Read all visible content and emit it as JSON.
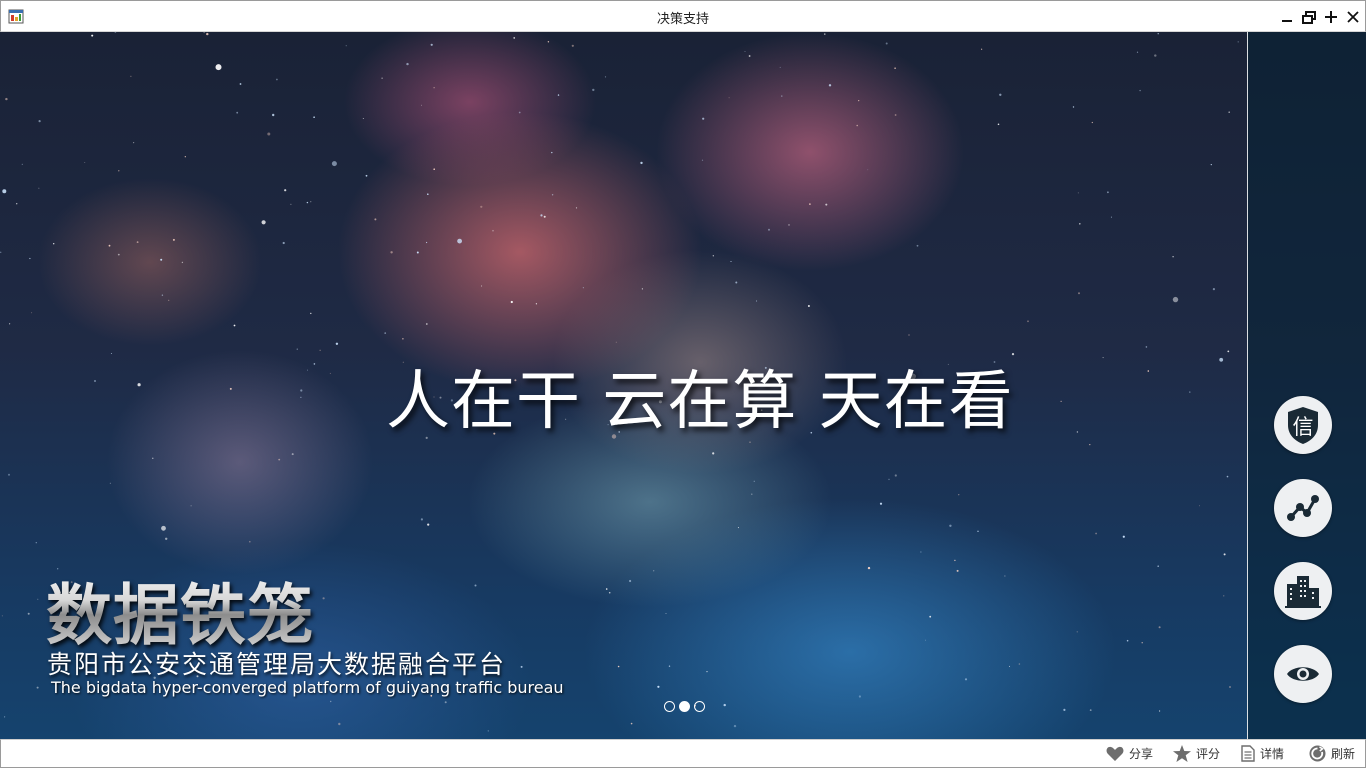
{
  "window": {
    "title": "决策支持",
    "controls": [
      "minimize",
      "restore",
      "maximize",
      "close"
    ]
  },
  "hero": {
    "slogan": "人在干  云在算  天在看",
    "logo_title": "数据铁笼",
    "logo_subtitle": "贵阳市公安交通管理局大数据融合平台",
    "logo_english": "The bigdata hyper-converged platform of guiyang traffic bureau",
    "carousel": {
      "count": 3,
      "active_index": 1
    }
  },
  "side_buttons": [
    {
      "icon": "xin-shield-icon",
      "glyph": "信"
    },
    {
      "icon": "network-nodes-icon"
    },
    {
      "icon": "buildings-icon"
    },
    {
      "icon": "eye-icon"
    }
  ],
  "toolbar": {
    "share_label": "分享",
    "rate_label": "评分",
    "detail_label": "详情",
    "refresh_label": "刷新"
  },
  "colors": {
    "panel_overlay": "#062234",
    "button_bg": "#eef0f2",
    "icon_dark": "#1a2a35"
  }
}
